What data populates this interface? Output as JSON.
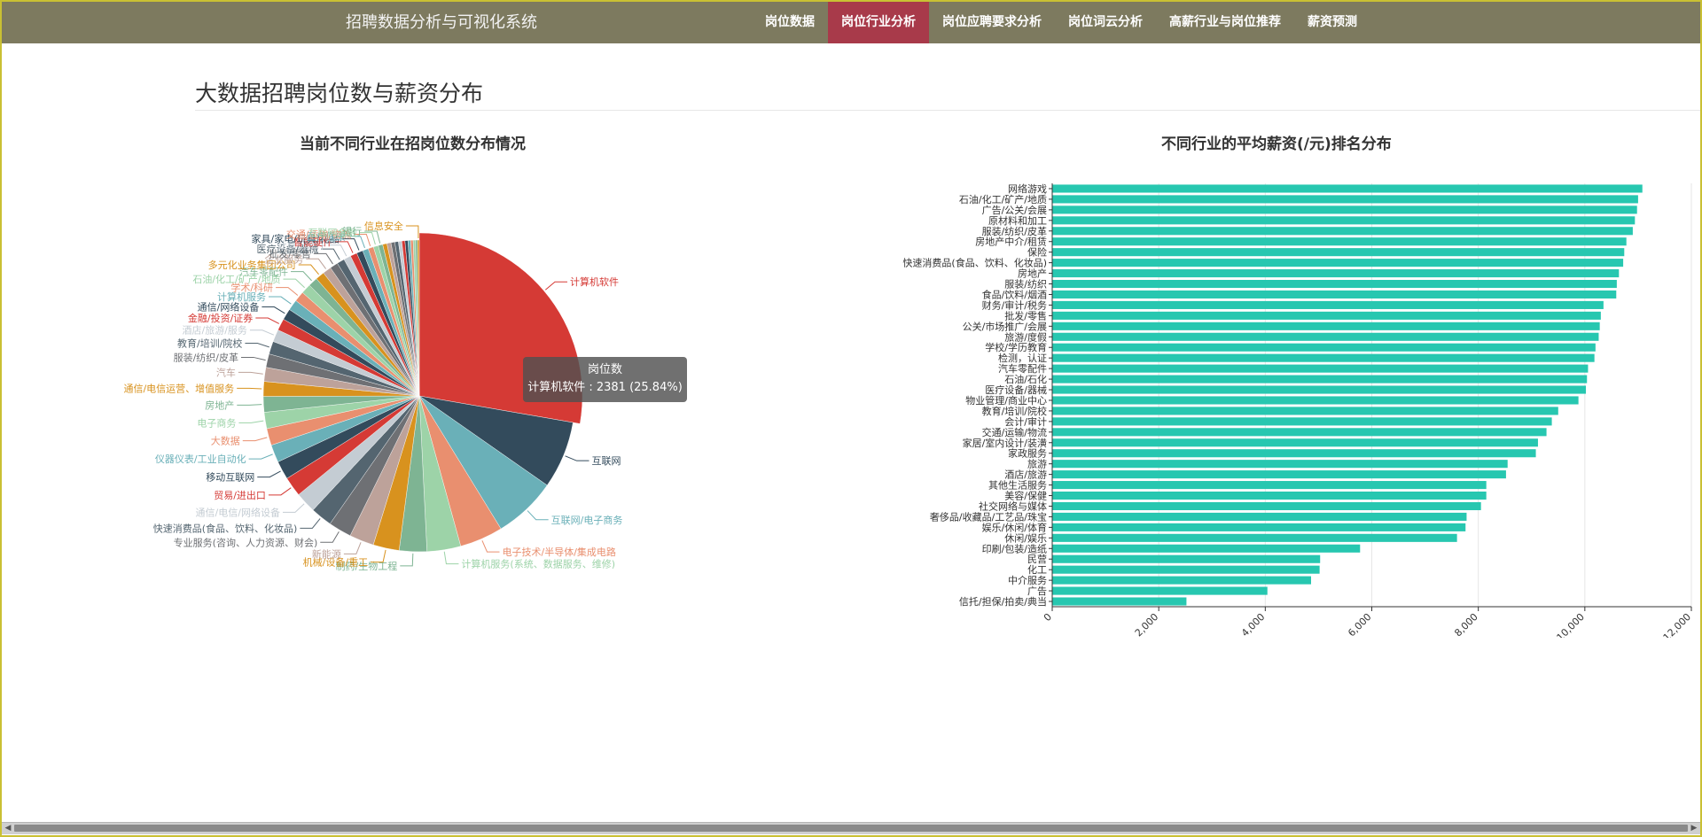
{
  "nav": {
    "brand": "招聘数据分析与可视化系统",
    "items": [
      "岗位数据",
      "岗位行业分析",
      "岗位应聘要求分析",
      "岗位词云分析",
      "高薪行业与岗位推荐",
      "薪资预测"
    ]
  },
  "page": {
    "heading": "大数据招聘岗位数与薪资分布"
  },
  "tooltip": {
    "title": "岗位数",
    "body": "计算机软件 : 2381 (25.84%)"
  },
  "chart_data": [
    {
      "type": "pie",
      "title": "当前不同行业在招岗位数分布情况",
      "series_name": "岗位数",
      "slices": [
        {
          "name": "计算机软件",
          "value": 2381,
          "color": "#d53a35"
        },
        {
          "name": "互联网",
          "value": 600,
          "color": "#334b5c"
        },
        {
          "name": "互联网/电子商务",
          "value": 560,
          "color": "#6ab0b8"
        },
        {
          "name": "电子技术/半导体/集成电路",
          "value": 385,
          "color": "#e98f6f"
        },
        {
          "name": "计算机服务(系统、数据服务、维修)",
          "value": 300,
          "color": "#9dd3a8"
        },
        {
          "name": "制药/生物工程",
          "value": 245,
          "color": "#7eb493"
        },
        {
          "name": "机械/设备/重工",
          "value": 232,
          "color": "#d8921e"
        },
        {
          "name": "新能源",
          "value": 218,
          "color": "#bda29a"
        },
        {
          "name": "专业服务(咨询、人力资源、财会)",
          "value": 205,
          "color": "#6e7074"
        },
        {
          "name": "快速消费品(食品、饮料、化妆品)",
          "value": 192,
          "color": "#546570"
        },
        {
          "name": "通信/电信/网络设备",
          "value": 185,
          "color": "#c4ccd3"
        },
        {
          "name": "贸易/进出口",
          "value": 175,
          "color": "#d53a35"
        },
        {
          "name": "移动互联网",
          "value": 165,
          "color": "#334b5c"
        },
        {
          "name": "仪器仪表/工业自动化",
          "value": 158,
          "color": "#6ab0b8"
        },
        {
          "name": "大数据",
          "value": 150,
          "color": "#e98f6f"
        },
        {
          "name": "电子商务",
          "value": 145,
          "color": "#9dd3a8"
        },
        {
          "name": "房地产",
          "value": 140,
          "color": "#7eb493"
        },
        {
          "name": "通信/电信运营、增值服务",
          "value": 132,
          "color": "#d8921e"
        },
        {
          "name": "汽车",
          "value": 125,
          "color": "#bda29a"
        },
        {
          "name": "服装/纺织/皮革",
          "value": 120,
          "color": "#6e7074"
        },
        {
          "name": "教育/培训/院校",
          "value": 115,
          "color": "#546570"
        },
        {
          "name": "酒店/旅游/服务",
          "value": 110,
          "color": "#c4ccd3"
        },
        {
          "name": "金融/投资/证券",
          "value": 105,
          "color": "#d53a35"
        },
        {
          "name": "通信/网络设备",
          "value": 100,
          "color": "#334b5c"
        },
        {
          "name": "计算机服务",
          "value": 96,
          "color": "#6ab0b8"
        },
        {
          "name": "学术/科研",
          "value": 92,
          "color": "#e98f6f"
        },
        {
          "name": "石油/化工/矿产/地质",
          "value": 88,
          "color": "#9dd3a8"
        },
        {
          "name": "汽车零配件",
          "value": 84,
          "color": "#7eb493"
        },
        {
          "name": "多元化业务集团公司",
          "value": 80,
          "color": "#d8921e"
        },
        {
          "name": "企业服务",
          "value": 76,
          "color": "#bda29a"
        },
        {
          "name": "批发/零售",
          "value": 72,
          "color": "#6e7074"
        },
        {
          "name": "医疗设备/器械",
          "value": 68,
          "color": "#546570"
        },
        {
          "name": "计算机硬件",
          "value": 64,
          "color": "#c4ccd3"
        },
        {
          "name": "智能硬件",
          "value": 60,
          "color": "#d53a35"
        },
        {
          "name": "家具/家电/玩具/礼品",
          "value": 56,
          "color": "#334b5c"
        },
        {
          "name": "医疗健康",
          "value": 52,
          "color": "#6ab0b8"
        },
        {
          "name": "交通/运输/物流",
          "value": 48,
          "color": "#e98f6f"
        },
        {
          "name": "互联网金融",
          "value": 44,
          "color": "#9dd3a8"
        },
        {
          "name": "银行",
          "value": 40,
          "color": "#7eb493"
        },
        {
          "name": "",
          "value": 38,
          "color": "#d8921e"
        },
        {
          "name": "",
          "value": 36,
          "color": "#bda29a"
        },
        {
          "name": "",
          "value": 34,
          "color": "#6e7074"
        },
        {
          "name": "",
          "value": 32,
          "color": "#546570"
        },
        {
          "name": "",
          "value": 30,
          "color": "#c4ccd3"
        },
        {
          "name": "",
          "value": 28,
          "color": "#d53a35"
        },
        {
          "name": "",
          "value": 26,
          "color": "#334b5c"
        },
        {
          "name": "",
          "value": 24,
          "color": "#6ab0b8"
        },
        {
          "name": "",
          "value": 22,
          "color": "#e98f6f"
        },
        {
          "name": "",
          "value": 20,
          "color": "#9dd3a8"
        },
        {
          "name": "",
          "value": 18,
          "color": "#7eb493"
        },
        {
          "name": "信息安全",
          "value": 16,
          "color": "#d8921e"
        }
      ]
    },
    {
      "type": "bar",
      "orientation": "horizontal",
      "title": "不同行业的平均薪资(/元)排名分布",
      "bar_color": "#27c7b0",
      "xlim": [
        0,
        12000
      ],
      "xticks": [
        0,
        2000,
        4000,
        6000,
        8000,
        10000,
        12000
      ],
      "xtick_labels": [
        "0",
        "2,000",
        "4,000",
        "6,000",
        "8,000",
        "10,000",
        "12,000"
      ],
      "grid": true,
      "categories": [
        "网络游戏",
        "石油/化工/矿产/地质",
        "广告/公关/会展",
        "原材料和加工",
        "服装/纺织/皮革",
        "房地产中介/租赁",
        "保险",
        "快速消费品(食品、饮料、化妆品)",
        "房地产",
        "服装/纺织",
        "食品/饮料/烟酒",
        "财务/审计/税务",
        "批发/零售",
        "公关/市场推广/会展",
        "旅游/度假",
        "学校/学历教育",
        "检测，认证",
        "汽车零配件",
        "石油/石化",
        "医疗设备/器械",
        "物业管理/商业中心",
        "教育/培训/院校",
        "会计/审计",
        "交通/运输/物流",
        "家居/室内设计/装潢",
        "家政服务",
        "旅游",
        "酒店/旅游",
        "其他生活服务",
        "美容/保健",
        "社交网络与媒体",
        "奢侈品/收藏品/工艺品/珠宝",
        "娱乐/休闲/体育",
        "休闲/娱乐",
        "印刷/包装/造纸",
        "民营",
        "化工",
        "中介服务",
        "广告",
        "信托/担保/拍卖/典当"
      ],
      "values": [
        11080,
        11000,
        10980,
        10940,
        10900,
        10780,
        10740,
        10720,
        10640,
        10600,
        10590,
        10350,
        10300,
        10280,
        10260,
        10200,
        10180,
        10060,
        10040,
        10020,
        9880,
        9500,
        9380,
        9280,
        9120,
        9080,
        8550,
        8520,
        8150,
        8150,
        8050,
        7780,
        7760,
        7600,
        5780,
        5030,
        5020,
        4860,
        4040,
        2520
      ]
    }
  ]
}
